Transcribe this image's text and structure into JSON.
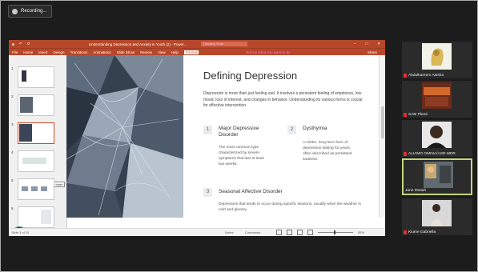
{
  "recording": {
    "label": "Recording..."
  },
  "titlebar": {
    "doc_title": "Understanding Depression and Anxiety in Youth (2) · Power...",
    "search": "Drawing Tools"
  },
  "ribbon": {
    "tabs": [
      "File",
      "Home",
      "Insert",
      "Design",
      "Transitions",
      "Animations",
      "Slide Show",
      "Review",
      "View",
      "Help",
      "Format"
    ],
    "tell_me": "Tell me what you want to do",
    "share": "Share"
  },
  "thumbnails": {
    "numbers": [
      "1",
      "2",
      "3",
      "4",
      "5",
      "6"
    ],
    "tooltip": "Top Inset"
  },
  "slide": {
    "title": "Defining Depression",
    "intro": "Depression is more than just feeling sad. It involves a persistent feeling of emptiness, low mood, loss of interest, and changes in behavior. Understanding its various forms is crucial for effective intervention.",
    "items": [
      {
        "num": "1",
        "heading": "Major Depressive Disorder",
        "body": "The most common type characterized by severe symptoms that last at least two weeks."
      },
      {
        "num": "2",
        "heading": "Dysthymia",
        "body": "A milder, long-term form of depression lasting for years, often described as persistent sadness."
      },
      {
        "num": "3",
        "heading": "Seasonal Affective Disorder",
        "body": "Depression that tends to occur during specific seasons, usually when the weather is cold and gloomy."
      }
    ]
  },
  "statusbar": {
    "slide_info": "Slide 3 of 10",
    "notes": "Notes",
    "comments": "Comments",
    "zoom": "95%"
  },
  "participants": [
    {
      "name": "Abdulkareem Aaisha"
    },
    {
      "name": "SAM Plenti"
    },
    {
      "name": "ALIAMO OMINA/ASD-MDR"
    },
    {
      "name": "Jane Mutiah"
    },
    {
      "name": "Kiume Gabriella"
    }
  ],
  "colors": {
    "accent": "#b7472a",
    "active_tile_border": "#c2d67e"
  }
}
